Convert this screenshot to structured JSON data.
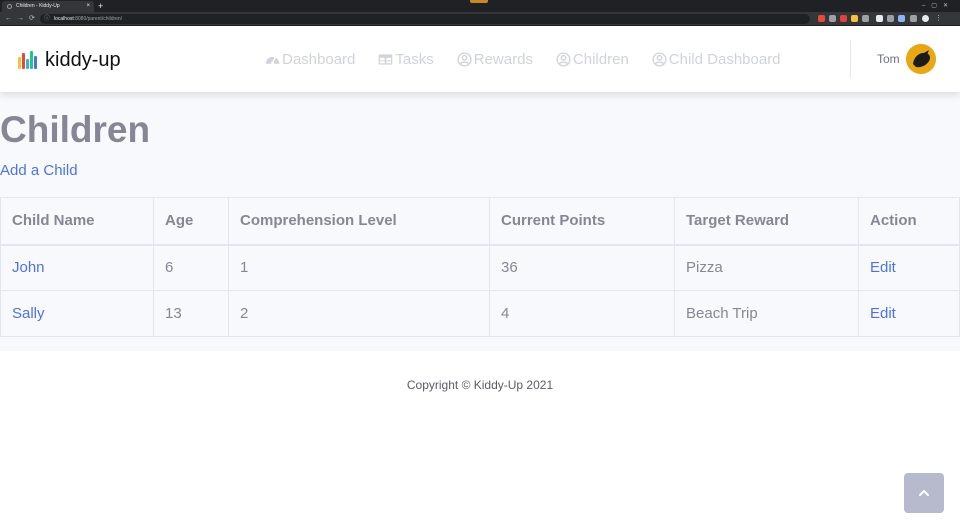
{
  "browser": {
    "tab_title": "Children - Kiddy-Up",
    "tab_close": "×",
    "new_tab": "+",
    "url_host": "localhost",
    "url_rest": ":8080/parent/children/"
  },
  "brand": {
    "name": "kiddy-up",
    "bar_colors": [
      "#f6c23e",
      "#e74a3b",
      "#36b9cc",
      "#1cc88a",
      "#4e73df"
    ]
  },
  "nav": {
    "items": [
      {
        "label": "Dashboard",
        "icon": "speedometer-icon"
      },
      {
        "label": "Tasks",
        "icon": "table-icon"
      },
      {
        "label": "Rewards",
        "icon": "user-circle-icon"
      },
      {
        "label": "Children",
        "icon": "user-circle-icon"
      },
      {
        "label": "Child Dashboard",
        "icon": "user-circle-icon"
      }
    ]
  },
  "user": {
    "name": "Tom"
  },
  "page": {
    "title": "Children",
    "add_link": "Add a Child"
  },
  "table": {
    "headers": [
      "Child Name",
      "Age",
      "Comprehension Level",
      "Current Points",
      "Target Reward",
      "Action"
    ],
    "rows": [
      {
        "name": "John",
        "age": "6",
        "level": "1",
        "points": "36",
        "reward": "Pizza",
        "action": "Edit"
      },
      {
        "name": "Sally",
        "age": "13",
        "level": "2",
        "points": "4",
        "reward": "Beach Trip",
        "action": "Edit"
      }
    ]
  },
  "footer": {
    "text": "Copyright © Kiddy-Up 2021"
  },
  "colors": {
    "primary": "#4e73df",
    "muted_text": "#858796",
    "nav_inactive": "#d0d3da"
  }
}
